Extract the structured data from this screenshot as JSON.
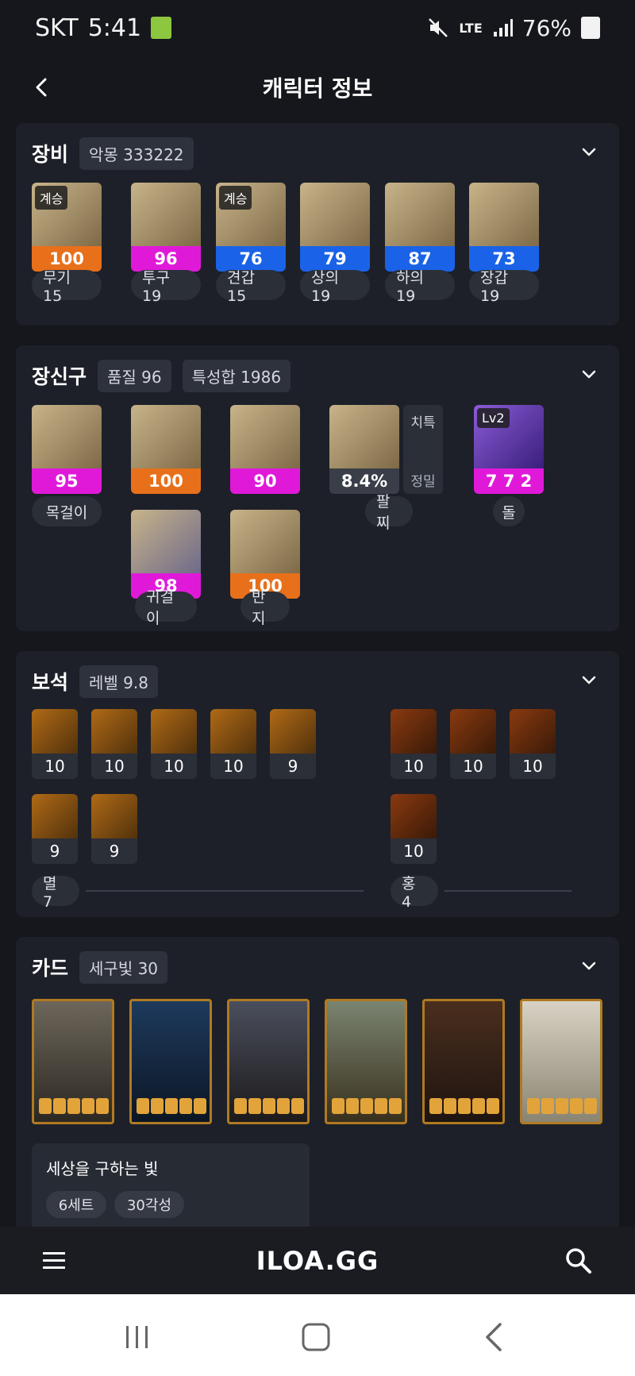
{
  "status": {
    "carrier": "SKT",
    "time": "5:41",
    "network": "LTE",
    "battery": "76%"
  },
  "header": {
    "title": "캐릭터 정보"
  },
  "equipment": {
    "title": "장비",
    "badge": "악몽 333222",
    "items": [
      {
        "tag": "계승",
        "value": "100",
        "color": "#e8701a",
        "label": "무기 15"
      },
      {
        "tag": "",
        "value": "96",
        "color": "#e019d9",
        "label": "투구 19"
      },
      {
        "tag": "계승",
        "value": "76",
        "color": "#1a63e8",
        "label": "견갑 15"
      },
      {
        "tag": "",
        "value": "79",
        "color": "#1a63e8",
        "label": "상의 19"
      },
      {
        "tag": "",
        "value": "87",
        "color": "#1a63e8",
        "label": "하의 19"
      },
      {
        "tag": "",
        "value": "73",
        "color": "#1a63e8",
        "label": "장갑 19"
      }
    ]
  },
  "accessories": {
    "title": "장신구",
    "badge1": "품질 96",
    "badge2": "특성합 1986",
    "necklace": {
      "value": "95",
      "label": "목걸이"
    },
    "earring1": {
      "value": "100"
    },
    "ring1": {
      "value": "90"
    },
    "bracelet": {
      "value": "8.4%",
      "label": "팔찌",
      "side1": "치특",
      "side2": "정밀"
    },
    "stone": {
      "tag": "Lv2",
      "value": "7 7 2",
      "label": "돌"
    },
    "earring2": {
      "value": "98",
      "label": "귀걸이"
    },
    "ring2": {
      "value": "100",
      "label": "반지"
    }
  },
  "gems": {
    "title": "보석",
    "badge": "레벨 9.8",
    "left_values": [
      "10",
      "10",
      "10",
      "10",
      "9",
      "9",
      "9"
    ],
    "right_values": [
      "10",
      "10",
      "10",
      "10"
    ],
    "left_label": "멸 7",
    "right_label": "홍 4"
  },
  "cards": {
    "title": "카드",
    "badge": "세구빛 30",
    "set_name": "세상을 구하는 빛",
    "set_tag1": "6세트",
    "set_tag2": "30각성"
  },
  "bottom_nav": {
    "logo": "ILOA.GG"
  }
}
